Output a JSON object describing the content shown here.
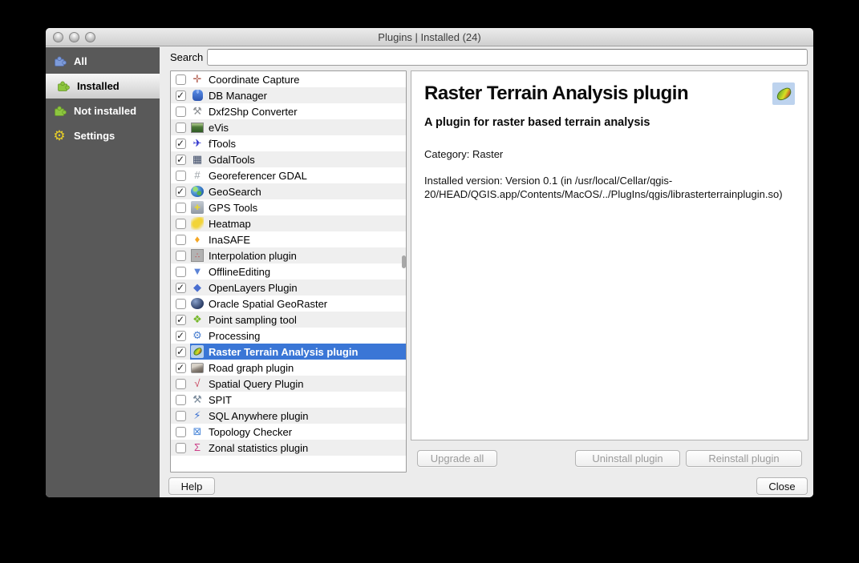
{
  "window": {
    "title": "Plugins | Installed (24)",
    "traffic_lights": [
      "close",
      "minimize",
      "zoom"
    ]
  },
  "sidebar": {
    "items": [
      {
        "label": "All",
        "icon": "puzzle-blue",
        "selected": false
      },
      {
        "label": "Installed",
        "icon": "puzzle-green",
        "selected": true
      },
      {
        "label": "Not installed",
        "icon": "puzzle-green",
        "selected": false
      },
      {
        "label": "Settings",
        "icon": "gear-yellow",
        "selected": false
      }
    ]
  },
  "search": {
    "label": "Search",
    "value": ""
  },
  "plugin_list": [
    {
      "name": "Coordinate Capture",
      "checked": false,
      "selected": false,
      "icon": "coordinate-capture"
    },
    {
      "name": "DB Manager",
      "checked": true,
      "selected": false,
      "icon": "db-manager"
    },
    {
      "name": "Dxf2Shp Converter",
      "checked": false,
      "selected": false,
      "icon": "dxf2shp"
    },
    {
      "name": "eVis",
      "checked": false,
      "selected": false,
      "icon": "evis"
    },
    {
      "name": "fTools",
      "checked": true,
      "selected": false,
      "icon": "ftools"
    },
    {
      "name": "GdalTools",
      "checked": true,
      "selected": false,
      "icon": "gdaltools"
    },
    {
      "name": "Georeferencer GDAL",
      "checked": false,
      "selected": false,
      "icon": "georeferencer"
    },
    {
      "name": "GeoSearch",
      "checked": true,
      "selected": false,
      "icon": "geosearch"
    },
    {
      "name": "GPS Tools",
      "checked": false,
      "selected": false,
      "icon": "gps-tools"
    },
    {
      "name": "Heatmap",
      "checked": false,
      "selected": false,
      "icon": "heatmap"
    },
    {
      "name": "InaSAFE",
      "checked": false,
      "selected": false,
      "icon": "inasafe"
    },
    {
      "name": "Interpolation plugin",
      "checked": false,
      "selected": false,
      "icon": "interpolation"
    },
    {
      "name": "OfflineEditing",
      "checked": false,
      "selected": false,
      "icon": "offline-editing"
    },
    {
      "name": "OpenLayers Plugin",
      "checked": true,
      "selected": false,
      "icon": "openlayers"
    },
    {
      "name": "Oracle Spatial GeoRaster",
      "checked": false,
      "selected": false,
      "icon": "oracle-georaster"
    },
    {
      "name": "Point sampling tool",
      "checked": true,
      "selected": false,
      "icon": "point-sampling"
    },
    {
      "name": "Processing",
      "checked": true,
      "selected": false,
      "icon": "processing"
    },
    {
      "name": "Raster Terrain Analysis plugin",
      "checked": true,
      "selected": true,
      "icon": "raster-terrain"
    },
    {
      "name": "Road graph plugin",
      "checked": true,
      "selected": false,
      "icon": "road-graph"
    },
    {
      "name": "Spatial Query Plugin",
      "checked": false,
      "selected": false,
      "icon": "spatial-query"
    },
    {
      "name": "SPIT",
      "checked": false,
      "selected": false,
      "icon": "spit"
    },
    {
      "name": "SQL Anywhere plugin",
      "checked": false,
      "selected": false,
      "icon": "sql-anywhere"
    },
    {
      "name": "Topology Checker",
      "checked": false,
      "selected": false,
      "icon": "topology-checker"
    },
    {
      "name": "Zonal statistics plugin",
      "checked": false,
      "selected": false,
      "icon": "zonal-stats"
    }
  ],
  "details": {
    "title": "Raster Terrain Analysis plugin",
    "subtitle": "A plugin for raster based terrain analysis",
    "category": "Category: Raster",
    "installed_version": "Installed version: Version 0.1 (in /usr/local/Cellar/qgis-20/HEAD/QGIS.app/Contents/MacOS/../PlugIns/qgis/librasterterrainplugin.so)"
  },
  "buttons": {
    "upgrade_all": {
      "label": "Upgrade all",
      "enabled": false
    },
    "uninstall": {
      "label": "Uninstall plugin",
      "enabled": false
    },
    "reinstall": {
      "label": "Reinstall plugin",
      "enabled": false
    },
    "help": {
      "label": "Help",
      "enabled": true
    },
    "close": {
      "label": "Close",
      "enabled": true
    }
  },
  "icons": {
    "puzzle-blue": {
      "type": "puzzle",
      "color": "#7d9bd9",
      "stroke": "#5570b0"
    },
    "puzzle-green": {
      "type": "puzzle",
      "color": "#8dc63f",
      "stroke": "#6a9a2a"
    },
    "gear-yellow": {
      "type": "glyph",
      "glyph": "⚙",
      "color": "#e8cf28"
    },
    "coordinate-capture": {
      "type": "glyph",
      "glyph": "✛",
      "color": "#b25d4f"
    },
    "db-manager": {
      "type": "shape",
      "shape": "db"
    },
    "dxf2shp": {
      "type": "glyph",
      "glyph": "⚒",
      "color": "#8d9094"
    },
    "evis": {
      "type": "shape",
      "shape": "photo"
    },
    "ftools": {
      "type": "glyph",
      "glyph": "✈",
      "color": "#2a2ecc"
    },
    "gdaltools": {
      "type": "glyph",
      "glyph": "▦",
      "color": "#3c4a66"
    },
    "georeferencer": {
      "type": "glyph",
      "glyph": "#",
      "color": "#9aa0a6"
    },
    "geosearch": {
      "type": "shape",
      "shape": "globe"
    },
    "gps-tools": {
      "type": "shape",
      "shape": "gps",
      "glyph": "✚"
    },
    "heatmap": {
      "type": "shape",
      "shape": "heat"
    },
    "inasafe": {
      "type": "glyph",
      "glyph": "♦",
      "color": "#f5a623"
    },
    "interpolation": {
      "type": "shape",
      "shape": "interp",
      "glyph": "∴"
    },
    "offline-editing": {
      "type": "glyph",
      "glyph": "▼",
      "color": "#5b83d6"
    },
    "openlayers": {
      "type": "glyph",
      "glyph": "◆",
      "color": "#4a6fd0"
    },
    "oracle-georaster": {
      "type": "shape",
      "shape": "orb"
    },
    "point-sampling": {
      "type": "glyph",
      "glyph": "❖",
      "color": "#76b82a"
    },
    "processing": {
      "type": "glyph",
      "glyph": "⚙",
      "color": "#4a7fd0"
    },
    "raster-terrain": {
      "type": "shape",
      "shape": "leaf"
    },
    "road-graph": {
      "type": "shape",
      "shape": "road"
    },
    "spatial-query": {
      "type": "glyph",
      "glyph": "√",
      "color": "#c8405a"
    },
    "spit": {
      "type": "glyph",
      "glyph": "⚒",
      "color": "#7a8a9a"
    },
    "sql-anywhere": {
      "type": "glyph",
      "glyph": "⚡",
      "color": "#3a6fd0"
    },
    "topology-checker": {
      "type": "glyph",
      "glyph": "⊠",
      "color": "#4a86d8"
    },
    "zonal-stats": {
      "type": "glyph",
      "glyph": "Σ",
      "color": "#cc3f88"
    }
  },
  "colors": {
    "selection_blue": "#3a76d6",
    "sidebar_bg": "#595959",
    "window_bg": "#ececec",
    "list_alt_row": "#efefef",
    "detail_icon_bg": "#bdd3ee"
  }
}
